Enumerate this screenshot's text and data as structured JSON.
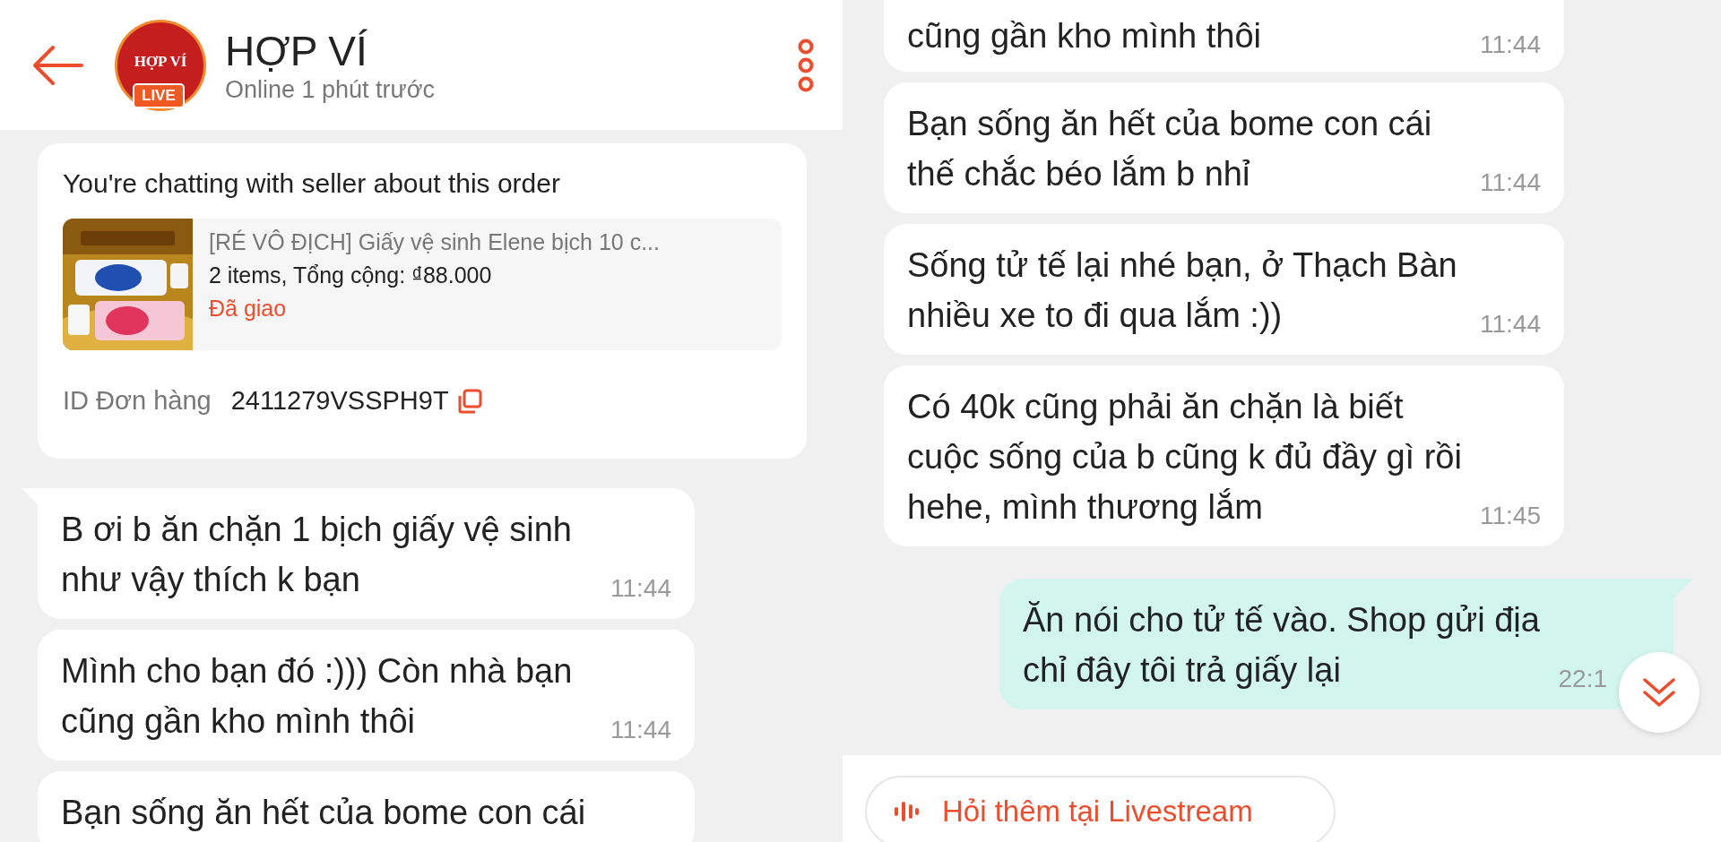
{
  "header": {
    "title": "HỢP VÍ",
    "status": "Online 1 phút trước",
    "avatar_text": "HỢP VÍ",
    "avatar_badge": "LIVE"
  },
  "order_card": {
    "heading": "You're chatting with seller about this order",
    "product_title": "[RÉ VÔ ĐỊCH] Giấy vệ sinh Elene bịch 10 c...",
    "summary": "2 items, Tổng cộng: ₫88.000",
    "status": "Đã giao",
    "id_label": "ID Đơn hàng",
    "id_value": "2411279VSSPH9T"
  },
  "left_messages": [
    {
      "kind": "incoming",
      "tail": true,
      "text": "B ơi b ăn chặn 1 bịch giấy vệ sinh\nnhư vậy thích k bạn",
      "time": "11:44"
    },
    {
      "kind": "incoming",
      "tail": false,
      "text": "Mình cho bạn đó :))) Còn nhà bạn\ncũng gần kho mình thôi",
      "time": "11:44"
    },
    {
      "kind": "incoming",
      "tail": false,
      "text": "Bạn sống ăn hết của bome con cái"
    }
  ],
  "right_messages": [
    {
      "kind": "incoming",
      "tail": false,
      "text": "cũng gần kho mình thôi",
      "time": "11:44"
    },
    {
      "kind": "incoming",
      "tail": false,
      "text": "Bạn sống ăn hết của bome con cái\nthế chắc béo lắm b nhỉ",
      "time": "11:44"
    },
    {
      "kind": "incoming",
      "tail": false,
      "text": "Sống tử tế lại nhé bạn, ở Thạch Bàn\nnhiều xe to đi qua lắm :))",
      "time": "11:44"
    },
    {
      "kind": "incoming",
      "tail": false,
      "text": "Có 40k cũng phải ăn chặn là biết\ncuộc sống của b cũng k đủ đầy gì rồi\nhehe, mình thương lắm",
      "time": "11:45"
    },
    {
      "kind": "outgoing",
      "tail": true,
      "text": "Ăn nói cho tử tế vào. Shop gửi địa\nchỉ đây tôi trả giấy lại",
      "time": "22:1"
    }
  ],
  "livestream_button": "Hỏi thêm tại Livestream"
}
